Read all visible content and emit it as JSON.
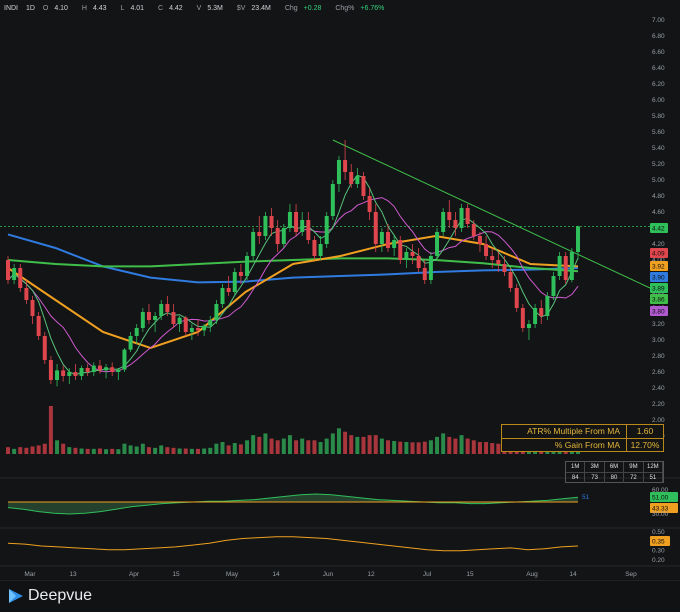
{
  "header": {
    "symbol": "INDI",
    "timeframe": "1D",
    "open_label": "O",
    "open": "4.10",
    "high_label": "H",
    "high": "4.43",
    "low_label": "L",
    "low": "4.01",
    "close_label": "C",
    "close": "4.42",
    "volume_label": "V",
    "volume": "5.3M",
    "dollar_volume_label": "$V",
    "dollar_volume": "23.4M",
    "change_label": "Chg",
    "change": "+0.28",
    "change_pct_label": "Chg%",
    "change_pct": "+6.76%"
  },
  "stats_table": {
    "rows": [
      {
        "label": "ATR% Multiple From MA",
        "value": "1.60"
      },
      {
        "label": "% Gain From MA",
        "value": "12.70%"
      }
    ]
  },
  "rs_table": {
    "headers": [
      "1M",
      "3M",
      "6M",
      "9M",
      "12M"
    ],
    "values": [
      "84",
      "73",
      "80",
      "72",
      "51"
    ]
  },
  "brand": "Deepvue",
  "colors": {
    "up": "#2fbf5b",
    "down": "#e0464d",
    "ma_orange": "#f0a020",
    "ma_blue": "#2f7be0",
    "ma_green": "#3fbf4a",
    "ma_pink": "#d05ad0",
    "trendline": "#3fbf4a"
  },
  "chart_data": [
    {
      "type": "candlestick",
      "title": "",
      "x_tick_labels": [
        "Mar",
        "13",
        "Apr",
        "15",
        "May",
        "14",
        "Jun",
        "12",
        "Jul",
        "15",
        "Aug",
        "14",
        "Sep"
      ],
      "y_ticks": [
        "7.00",
        "6.80",
        "6.60",
        "6.40",
        "6.20",
        "6.00",
        "5.80",
        "5.60",
        "5.40",
        "5.20",
        "5.00",
        "4.80",
        "4.60",
        "4.40",
        "4.20",
        "4.00",
        "3.80",
        "3.60",
        "3.40",
        "3.20",
        "3.00",
        "2.80",
        "2.60",
        "2.40",
        "2.20",
        "2.00",
        "1.80"
      ],
      "ylim": [
        1.7,
        7.1
      ],
      "price_tags": [
        {
          "value": "4.42",
          "color": "#2fbf5b"
        },
        {
          "value": "4.09",
          "color": "#e0464d"
        },
        {
          "value": "3.92",
          "color": "#f0a020"
        },
        {
          "value": "3.90",
          "color": "#2f7be0"
        },
        {
          "value": "3.89",
          "color": "#2fbf5b"
        },
        {
          "value": "3.86",
          "color": "#3fbf4a"
        },
        {
          "value": "3.80",
          "color": "#b05ad0"
        }
      ],
      "last_price": 4.42,
      "trendline": {
        "from": [
          "May 24",
          5.5
        ],
        "to": [
          "Aug 20",
          3.65
        ]
      },
      "series": [
        {
          "name": "Price",
          "key": "ohlc",
          "values": [
            [
              4.0,
              4.05,
              3.7,
              3.75
            ],
            [
              3.75,
              3.95,
              3.7,
              3.9
            ],
            [
              3.9,
              3.95,
              3.6,
              3.65
            ],
            [
              3.65,
              3.75,
              3.45,
              3.5
            ],
            [
              3.5,
              3.55,
              3.2,
              3.3
            ],
            [
              3.3,
              3.35,
              3.0,
              3.05
            ],
            [
              3.05,
              3.1,
              2.7,
              2.75
            ],
            [
              2.75,
              2.8,
              2.45,
              2.5
            ],
            [
              2.5,
              2.7,
              2.42,
              2.62
            ],
            [
              2.62,
              2.68,
              2.48,
              2.55
            ],
            [
              2.55,
              2.65,
              2.45,
              2.6
            ],
            [
              2.6,
              2.7,
              2.5,
              2.55
            ],
            [
              2.55,
              2.68,
              2.5,
              2.65
            ],
            [
              2.65,
              2.7,
              2.55,
              2.6
            ],
            [
              2.6,
              2.72,
              2.55,
              2.68
            ],
            [
              2.68,
              2.75,
              2.58,
              2.62
            ],
            [
              2.62,
              2.7,
              2.52,
              2.66
            ],
            [
              2.66,
              2.72,
              2.55,
              2.6
            ],
            [
              2.6,
              2.65,
              2.5,
              2.63
            ],
            [
              2.63,
              2.9,
              2.6,
              2.88
            ],
            [
              2.88,
              3.1,
              2.85,
              3.05
            ],
            [
              3.05,
              3.2,
              2.95,
              3.15
            ],
            [
              3.15,
              3.4,
              3.1,
              3.35
            ],
            [
              3.35,
              3.45,
              3.2,
              3.25
            ],
            [
              3.25,
              3.35,
              3.1,
              3.3
            ],
            [
              3.3,
              3.5,
              3.25,
              3.45
            ],
            [
              3.45,
              3.55,
              3.3,
              3.35
            ],
            [
              3.35,
              3.45,
              3.15,
              3.2
            ],
            [
              3.2,
              3.3,
              3.1,
              3.28
            ],
            [
              3.28,
              3.3,
              3.05,
              3.1
            ],
            [
              3.1,
              3.2,
              3.0,
              3.15
            ],
            [
              3.15,
              3.25,
              3.05,
              3.12
            ],
            [
              3.12,
              3.2,
              3.05,
              3.18
            ],
            [
              3.18,
              3.3,
              3.1,
              3.25
            ],
            [
              3.25,
              3.5,
              3.2,
              3.45
            ],
            [
              3.45,
              3.7,
              3.4,
              3.65
            ],
            [
              3.65,
              3.8,
              3.55,
              3.6
            ],
            [
              3.6,
              3.9,
              3.55,
              3.85
            ],
            [
              3.85,
              3.95,
              3.7,
              3.8
            ],
            [
              3.8,
              4.1,
              3.75,
              4.05
            ],
            [
              4.05,
              4.4,
              4.0,
              4.35
            ],
            [
              4.35,
              4.55,
              4.2,
              4.3
            ],
            [
              4.3,
              4.6,
              4.25,
              4.55
            ],
            [
              4.55,
              4.65,
              4.3,
              4.4
            ],
            [
              4.4,
              4.5,
              4.1,
              4.2
            ],
            [
              4.2,
              4.45,
              4.15,
              4.4
            ],
            [
              4.4,
              4.7,
              4.35,
              4.6
            ],
            [
              4.6,
              4.7,
              4.3,
              4.35
            ],
            [
              4.35,
              4.6,
              4.3,
              4.5
            ],
            [
              4.5,
              4.6,
              4.2,
              4.25
            ],
            [
              4.25,
              4.3,
              4.0,
              4.05
            ],
            [
              4.05,
              4.3,
              4.0,
              4.2
            ],
            [
              4.2,
              4.6,
              4.15,
              4.55
            ],
            [
              4.55,
              5.0,
              4.5,
              4.95
            ],
            [
              4.95,
              5.3,
              4.85,
              5.25
            ],
            [
              5.25,
              5.5,
              5.0,
              5.1
            ],
            [
              5.1,
              5.2,
              4.9,
              4.95
            ],
            [
              4.95,
              5.15,
              4.9,
              5.05
            ],
            [
              5.05,
              5.1,
              4.75,
              4.8
            ],
            [
              4.8,
              4.9,
              4.5,
              4.6
            ],
            [
              4.6,
              4.7,
              4.1,
              4.2
            ],
            [
              4.2,
              4.4,
              4.1,
              4.35
            ],
            [
              4.35,
              4.45,
              4.1,
              4.15
            ],
            [
              4.15,
              4.3,
              4.05,
              4.25
            ],
            [
              4.25,
              4.3,
              3.95,
              4.0
            ],
            [
              4.0,
              4.15,
              3.9,
              4.1
            ],
            [
              4.1,
              4.2,
              3.95,
              4.05
            ],
            [
              4.05,
              4.15,
              3.85,
              3.9
            ],
            [
              3.9,
              4.0,
              3.7,
              3.75
            ],
            [
              3.75,
              4.1,
              3.7,
              4.05
            ],
            [
              4.05,
              4.4,
              4.0,
              4.35
            ],
            [
              4.35,
              4.65,
              4.3,
              4.6
            ],
            [
              4.6,
              4.75,
              4.4,
              4.5
            ],
            [
              4.5,
              4.6,
              4.3,
              4.4
            ],
            [
              4.4,
              4.7,
              4.35,
              4.65
            ],
            [
              4.65,
              4.7,
              4.4,
              4.45
            ],
            [
              4.45,
              4.5,
              4.25,
              4.3
            ],
            [
              4.3,
              4.35,
              4.1,
              4.2
            ],
            [
              4.2,
              4.3,
              4.0,
              4.05
            ],
            [
              4.05,
              4.15,
              3.9,
              4.0
            ],
            [
              4.0,
              4.1,
              3.85,
              3.95
            ],
            [
              3.95,
              4.05,
              3.8,
              3.85
            ],
            [
              3.85,
              3.9,
              3.6,
              3.65
            ],
            [
              3.65,
              3.7,
              3.35,
              3.4
            ],
            [
              3.4,
              3.45,
              3.1,
              3.15
            ],
            [
              3.15,
              3.25,
              3.0,
              3.2
            ],
            [
              3.2,
              3.45,
              3.15,
              3.4
            ],
            [
              3.4,
              3.5,
              3.2,
              3.3
            ],
            [
              3.3,
              3.6,
              3.25,
              3.55
            ],
            [
              3.55,
              3.85,
              3.5,
              3.8
            ],
            [
              3.8,
              4.1,
              3.75,
              4.05
            ],
            [
              4.05,
              4.1,
              3.7,
              3.75
            ],
            [
              3.75,
              4.15,
              3.72,
              4.1
            ],
            [
              4.1,
              4.43,
              4.01,
              4.42
            ]
          ]
        },
        {
          "name": "MA orange",
          "key": "ma_orange",
          "values": [
            3.9,
            3.5,
            3.1,
            2.9,
            3.1,
            3.6,
            3.95,
            4.05,
            4.2,
            4.3,
            4.2,
            3.95,
            3.92
          ]
        },
        {
          "name": "MA blue",
          "key": "ma_blue",
          "values": [
            4.32,
            4.15,
            3.92,
            3.78,
            3.72,
            3.73,
            3.78,
            3.8,
            3.82,
            3.85,
            3.87,
            3.88,
            3.9
          ]
        },
        {
          "name": "MA green",
          "key": "ma_green",
          "values": [
            4.0,
            3.95,
            3.92,
            3.92,
            3.95,
            3.98,
            4.0,
            4.02,
            4.02,
            4.0,
            3.96,
            3.9,
            3.86
          ]
        }
      ]
    },
    {
      "type": "bar",
      "title": "",
      "key": "volume",
      "values": [
        2,
        1.5,
        2,
        1.8,
        2.2,
        2.5,
        3,
        14,
        4,
        3,
        2,
        1.8,
        1.6,
        1.5,
        1.5,
        1.6,
        1.4,
        1.5,
        1.4,
        3,
        2.5,
        2.2,
        3,
        2,
        1.8,
        2.5,
        2,
        1.8,
        1.6,
        1.6,
        1.5,
        1.5,
        1.6,
        1.8,
        3,
        3.5,
        2.5,
        3.2,
        2.8,
        4,
        5.5,
        5,
        6,
        4.5,
        4,
        4.5,
        5.5,
        4,
        4.5,
        4,
        4,
        3.5,
        4.5,
        6,
        7.5,
        6.5,
        5.5,
        5,
        5,
        5.5,
        5.5,
        4.5,
        4,
        3.8,
        3.6,
        3.5,
        3.4,
        3.4,
        3.6,
        4,
        5,
        6,
        5,
        4.5,
        5.5,
        4.5,
        4,
        3.5,
        3.5,
        3.2,
        3,
        3,
        3.5,
        4,
        4.5,
        4.2,
        3.5,
        3.2,
        3.6,
        4,
        4.5,
        4,
        4.5,
        5.3
      ]
    },
    {
      "type": "area",
      "title": "",
      "key": "rs_oscillator",
      "y_ticks": [
        "60.00",
        "30.00"
      ],
      "value_tags": [
        {
          "value": "51.00",
          "color": "#2fbf5b"
        },
        {
          "value": "43.33",
          "color": "#f0a020"
        }
      ],
      "annotation": "51",
      "values": [
        38,
        36,
        33,
        31,
        30,
        31,
        33,
        36,
        39,
        41,
        43,
        44,
        45,
        46,
        46,
        47,
        48,
        50,
        52,
        54,
        55,
        54,
        52,
        50,
        48,
        47,
        46,
        45,
        44,
        44,
        43,
        43,
        44,
        45,
        46,
        47,
        49,
        51
      ]
    },
    {
      "type": "line",
      "title": "",
      "key": "lower_indicator",
      "y_ticks": [
        "0.50",
        "0.30",
        "0.20"
      ],
      "value_tags": [
        {
          "value": "0.35",
          "color": "#f0a020"
        }
      ],
      "values": [
        0.38,
        0.37,
        0.35,
        0.34,
        0.33,
        0.32,
        0.31,
        0.31,
        0.32,
        0.33,
        0.34,
        0.36,
        0.38,
        0.41,
        0.43,
        0.44,
        0.45,
        0.45,
        0.44,
        0.43,
        0.41,
        0.39,
        0.37,
        0.35,
        0.33,
        0.31,
        0.3,
        0.3,
        0.31,
        0.32,
        0.33,
        0.31,
        0.32,
        0.34,
        0.35
      ]
    }
  ]
}
